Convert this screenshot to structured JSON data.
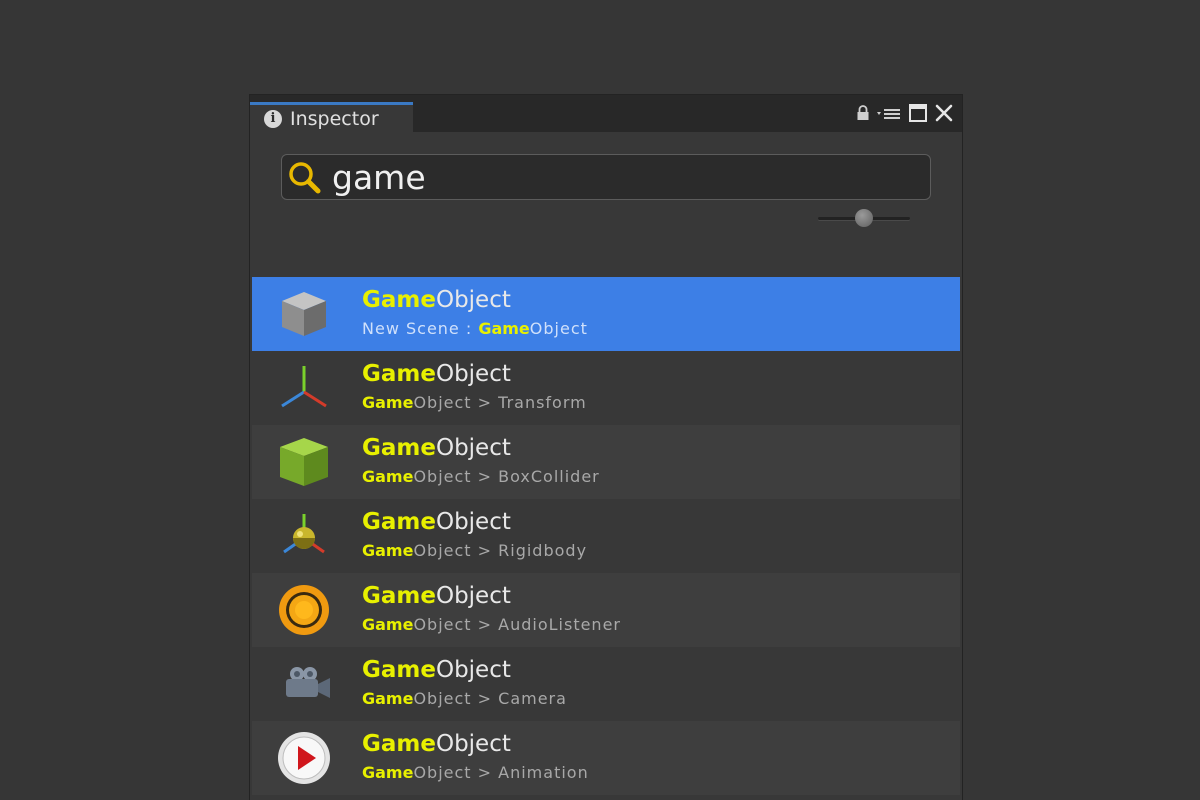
{
  "tab": {
    "label": "Inspector",
    "info_icon": "i",
    "accent": "#3a79c4"
  },
  "search": {
    "value": "game",
    "highlight_color": "#e8f000"
  },
  "zoom_slider": {
    "value": 0.5
  },
  "results": [
    {
      "title_match": "Game",
      "title_rest": "Object",
      "sub_prefix": "New Scene : ",
      "sub_match": "Game",
      "sub_rest": "Object",
      "icon": "gameobject-cube-icon",
      "selected": true
    },
    {
      "title_match": "Game",
      "title_rest": "Object",
      "sub_prefix": "",
      "sub_match": "Game",
      "sub_rest": "Object > Transform",
      "icon": "transform-axes-icon",
      "selected": false
    },
    {
      "title_match": "Game",
      "title_rest": "Object",
      "sub_prefix": "",
      "sub_match": "Game",
      "sub_rest": "Object > BoxCollider",
      "icon": "box-collider-icon",
      "selected": false
    },
    {
      "title_match": "Game",
      "title_rest": "Object",
      "sub_prefix": "",
      "sub_match": "Game",
      "sub_rest": "Object > Rigidbody",
      "icon": "rigidbody-icon",
      "selected": false
    },
    {
      "title_match": "Game",
      "title_rest": "Object",
      "sub_prefix": "",
      "sub_match": "Game",
      "sub_rest": "Object > AudioListener",
      "icon": "audio-listener-icon",
      "selected": false
    },
    {
      "title_match": "Game",
      "title_rest": "Object",
      "sub_prefix": "",
      "sub_match": "Game",
      "sub_rest": "Object > Camera",
      "icon": "camera-icon",
      "selected": false
    },
    {
      "title_match": "Game",
      "title_rest": "Object",
      "sub_prefix": "",
      "sub_match": "Game",
      "sub_rest": "Object > Animation",
      "icon": "animation-play-icon",
      "selected": false
    }
  ]
}
